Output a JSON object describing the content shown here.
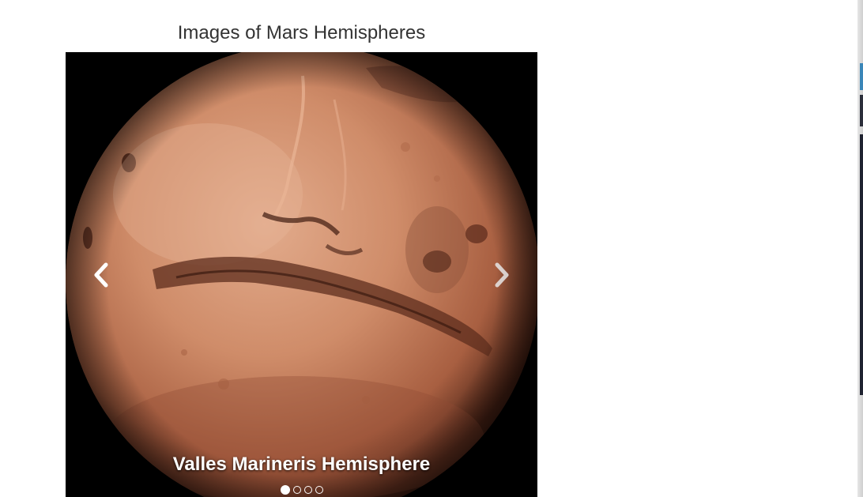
{
  "page": {
    "heading": "Images of Mars Hemispheres"
  },
  "carousel": {
    "slides": [
      {
        "caption": "Valles Marineris Hemisphere",
        "active": true
      },
      {
        "caption": "",
        "active": false
      },
      {
        "caption": "",
        "active": false
      },
      {
        "caption": "",
        "active": false
      }
    ],
    "active_index": 0,
    "prev_icon": "chevron-left-icon",
    "next_icon": "chevron-right-icon"
  },
  "colors": {
    "background": "#ffffff",
    "heading_text": "#333333",
    "carousel_background": "#000000",
    "mars_light": "#d99a78",
    "mars_mid": "#b8694a",
    "mars_dark": "#6e3523",
    "caption_text": "#ffffff"
  }
}
